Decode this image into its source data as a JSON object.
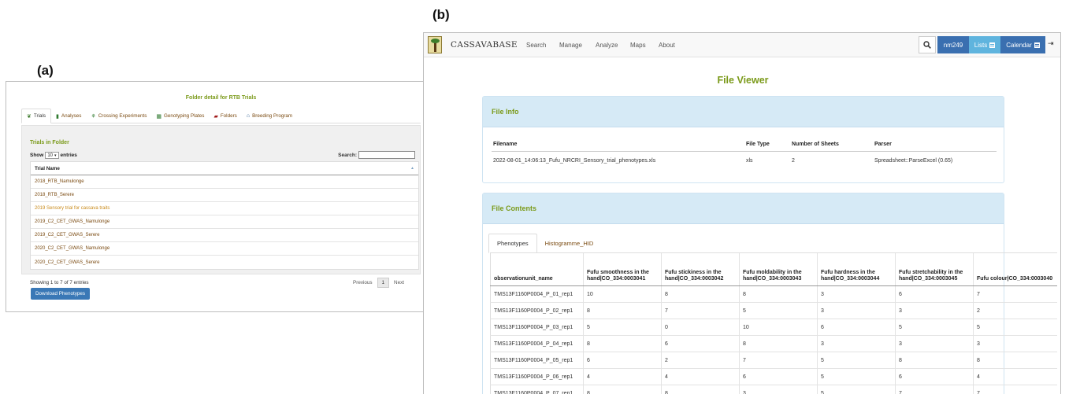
{
  "labels": {
    "a": "(a)",
    "b": "(b)"
  },
  "panel_a": {
    "title": "Folder detail for RTB Trials",
    "tabs": [
      {
        "label": "Trials",
        "icon": "leaf-icon"
      },
      {
        "label": "Analyses",
        "icon": "bar-chart-icon"
      },
      {
        "label": "Crossing Experiments",
        "icon": "flower-icon"
      },
      {
        "label": "Genotyping Plates",
        "icon": "grid-icon"
      },
      {
        "label": "Folders",
        "icon": "folder-icon"
      },
      {
        "label": "Breeding Program",
        "icon": "bank-icon"
      }
    ],
    "section_title": "Trials in Folder",
    "show_label": "Show",
    "show_value": "10",
    "entries_label": "entries",
    "search_label": "Search:",
    "column_header": "Trial Name",
    "rows": [
      "2018_RTB_Namulonge",
      "2018_RTB_Serere",
      "2019 Sensory trial for cassava traits",
      "2019_C2_CET_GWAS_Namulonge",
      "2019_C2_CET_GWAS_Serere",
      "2020_C2_CET_GWAS_Namulonge",
      "2020_C2_CET_GWAS_Serere"
    ],
    "footer": "Showing 1 to 7 of 7 entries",
    "pager": {
      "previous": "Previous",
      "page": "1",
      "next": "Next"
    },
    "download_label": "Download Phenotypes"
  },
  "panel_b": {
    "brand": "CASSAVABASE",
    "nav": [
      "Search",
      "Manage",
      "Analyze",
      "Maps",
      "About"
    ],
    "user": "nm249",
    "lists": "Lists",
    "calendar": "Calendar",
    "page_title": "File Viewer",
    "file_info": {
      "title": "File Info",
      "headers": [
        "Filename",
        "File Type",
        "Number of Sheets",
        "Parser"
      ],
      "values": [
        "2022-08-01_14:06:13_Fufu_NRCRI_Sensory_trial_phenotypes.xls",
        "xls",
        "2",
        "Spreadsheet::ParseExcel (0.65)"
      ]
    },
    "file_contents": {
      "title": "File Contents",
      "tabs": [
        "Phenotypes",
        "Histogramme_HID"
      ],
      "headers": [
        "observationunit_name",
        "Fufu smoothness in the hand|CO_334:0003041",
        "Fufu stickiness in the hand|CO_334:0003042",
        "Fufu moldability in the hand|CO_334:0003043",
        "Fufu hardness in the hand|CO_334:0003044",
        "Fufu stretchability in the hand|CO_334:0003045",
        "Fufu colour|CO_334:0003040"
      ],
      "rows": [
        [
          "TMS13F1160P0004_P_01_rep1",
          "10",
          "8",
          "8",
          "3",
          "6",
          "7"
        ],
        [
          "TMS13F1160P0004_P_02_rep1",
          "8",
          "7",
          "5",
          "3",
          "3",
          "2"
        ],
        [
          "TMS13F1160P0004_P_03_rep1",
          "5",
          "0",
          "10",
          "6",
          "5",
          "5"
        ],
        [
          "TMS13F1160P0004_P_04_rep1",
          "8",
          "6",
          "8",
          "3",
          "3",
          "3"
        ],
        [
          "TMS13F1160P0004_P_05_rep1",
          "6",
          "2",
          "7",
          "5",
          "8",
          "8"
        ],
        [
          "TMS13F1160P0004_P_06_rep1",
          "4",
          "4",
          "6",
          "5",
          "6",
          "4"
        ],
        [
          "TMS13F1160P0004_P_07_rep1",
          "8",
          "8",
          "3",
          "5",
          "7",
          "7"
        ]
      ]
    }
  }
}
